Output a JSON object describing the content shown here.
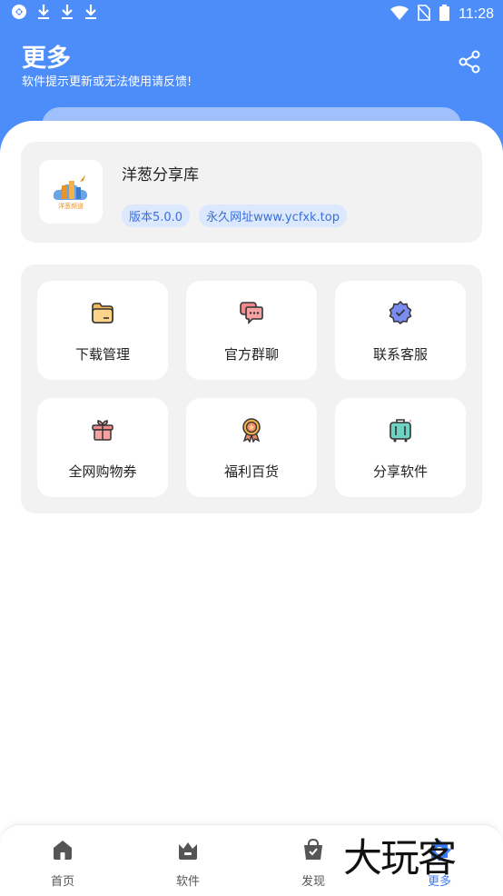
{
  "status_bar": {
    "time": "11:28",
    "left_icons": [
      "app-notification-icon",
      "download-icon",
      "download-icon",
      "download-icon"
    ],
    "right_icons": [
      "wifi-icon",
      "no-sim-icon",
      "battery-icon"
    ]
  },
  "header": {
    "title": "更多",
    "subtitle": "软件提示更新或无法使用请反馈!",
    "background": "#4c8dfa"
  },
  "app_info": {
    "name": "洋葱分享库",
    "logo_text": "洋葱频道",
    "version": "版本5.0.0",
    "url": "永久网址www.ycfxk.top"
  },
  "grid": {
    "items": [
      {
        "label": "下载管理",
        "icon": "folder-icon"
      },
      {
        "label": "官方群聊",
        "icon": "chat-bubbles-icon"
      },
      {
        "label": "联系客服",
        "icon": "verified-badge-icon"
      },
      {
        "label": "全网购物券",
        "icon": "gift-icon"
      },
      {
        "label": "福利百货",
        "icon": "award-medal-icon"
      },
      {
        "label": "分享软件",
        "icon": "suitcase-icon"
      }
    ]
  },
  "bottom_nav": {
    "items": [
      {
        "label": "首页",
        "icon": "home-icon",
        "active": false
      },
      {
        "label": "软件",
        "icon": "crown-icon",
        "active": false
      },
      {
        "label": "发现",
        "icon": "shopping-bag-icon",
        "active": false
      },
      {
        "label": "更多",
        "icon": "more-icon",
        "active": true
      }
    ]
  },
  "watermark": "大玩客",
  "colors": {
    "accent": "#4c8dfa",
    "badge_bg": "#dce8fd",
    "badge_text": "#3b6fd6",
    "card_bg": "#f2f2f2",
    "active_nav": "#3b7bf6"
  }
}
